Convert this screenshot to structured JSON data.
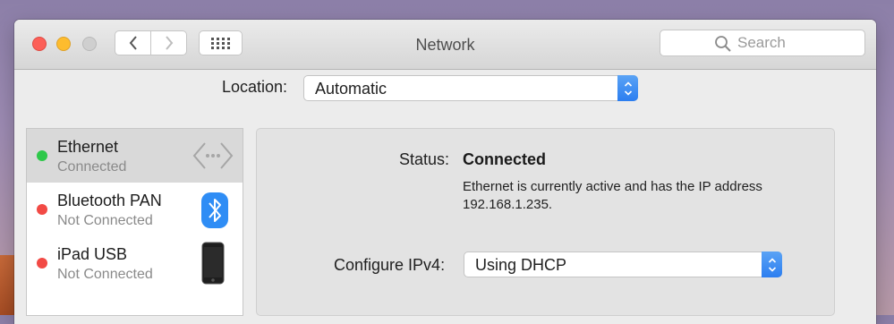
{
  "window": {
    "title": "Network"
  },
  "search": {
    "placeholder": "Search"
  },
  "location": {
    "label": "Location:",
    "value": "Automatic"
  },
  "services": [
    {
      "name": "Ethernet",
      "state": "Connected",
      "status_color": "#2ec84a",
      "icon": "ethernet-icon",
      "selected": true
    },
    {
      "name": "Bluetooth PAN",
      "state": "Not Connected",
      "status_color": "#f24a45",
      "icon": "bluetooth-icon",
      "selected": false
    },
    {
      "name": "iPad USB",
      "state": "Not Connected",
      "status_color": "#f24a45",
      "icon": "ipad-icon",
      "selected": false
    }
  ],
  "detail": {
    "status_label": "Status:",
    "status_value": "Connected",
    "status_description": "Ethernet is currently active and has the IP address 192.168.1.235.",
    "configure_ipv4_label": "Configure IPv4:",
    "configure_ipv4_value": "Using DHCP"
  },
  "colors": {
    "accent": "#2c7ef0",
    "close": "#fc5f57",
    "minimize": "#fdbc2e"
  }
}
